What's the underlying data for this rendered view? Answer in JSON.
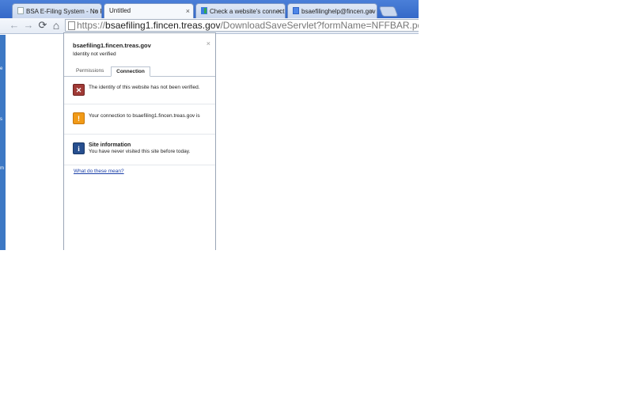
{
  "tabs": [
    {
      "title": "BSA E-Filing System - No Re",
      "icon": "page-icon",
      "active": false
    },
    {
      "title": "Untitled",
      "icon": "page-icon",
      "active": true
    },
    {
      "title": "Check a website's connectio",
      "icon": "google-colored-icon",
      "active": false
    },
    {
      "title": "bsaefilinghelp@fincen.gov -",
      "icon": "google-g-icon",
      "active": false
    }
  ],
  "tab_close_glyph": "×",
  "toolbar": {
    "back": "←",
    "forward": "→",
    "reload": "⟳",
    "home": "⌂"
  },
  "address": {
    "scheme": "https://",
    "host": "bsaefiling1.fincen.treas.gov",
    "path": "/DownloadSaveServlet?formName=NFFBAR.pdf"
  },
  "popup": {
    "hostname": "bsaefiling1.fincen.treas.gov",
    "identity_status": "Identity not verified",
    "close": "×",
    "tab_permissions": "Permissions",
    "tab_connection": "Connection",
    "identity_message": "The identity of this website has not been verified.",
    "connection_message": "Your connection to bsaefiling1.fincen.treas.gov is",
    "site_info_title": "Site information",
    "site_info_message": "You have never visited this site before today.",
    "help_link": "What do these mean?"
  },
  "left_strip_letters": [
    "e",
    "s",
    "m"
  ],
  "colors": {
    "tabstrip": "#3569c8",
    "warning_red": "#a03a36",
    "warning_orange": "#f19a17",
    "info_blue": "#274f8f",
    "link": "#1a3fa8"
  }
}
